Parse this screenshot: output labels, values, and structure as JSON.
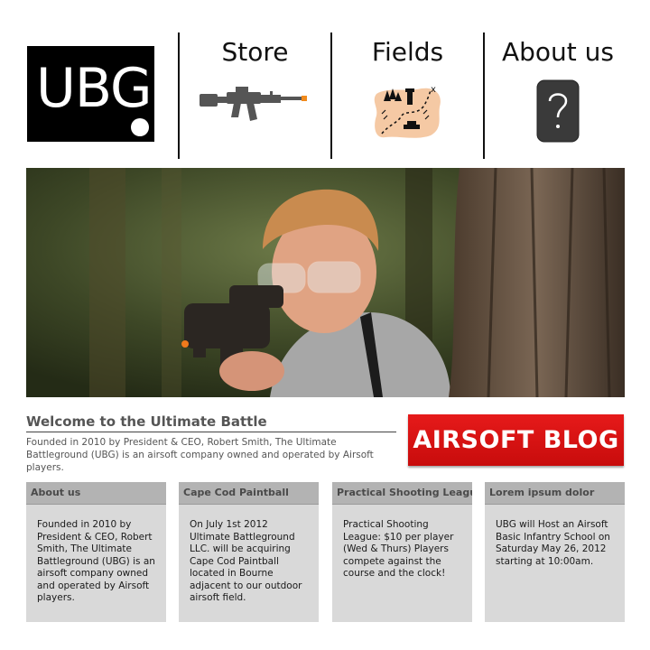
{
  "logo": {
    "text": "UBG"
  },
  "nav": [
    {
      "label": "Store",
      "icon": "rifle-icon"
    },
    {
      "label": "Fields",
      "icon": "treasure-map-icon"
    },
    {
      "label": "About us",
      "icon": "question-mark-icon"
    }
  ],
  "welcome": {
    "title": "Welcome to the Ultimate Battle",
    "text": "Founded in 2010 by President & CEO, Robert Smith, The Ultimate Battleground (UBG) is an airsoft company owned and operated by Airsoft players."
  },
  "blog_button": {
    "label": "AIRSOFT BLOG"
  },
  "columns": [
    {
      "title": "About us",
      "text": "Founded in 2010 by President & CEO, Robert Smith, The Ultimate Battleground (UBG) is an airsoft company owned and operated by Airsoft players."
    },
    {
      "title": "Cape Cod Paintball",
      "text": "On July 1st 2012 Ultimate Battleground LLC. will be acquiring Cape Cod Paintball located in Bourne adjacent to our outdoor airsoft field."
    },
    {
      "title": "Practical Shooting League:",
      "text": "Practical Shooting League: $10 per player (Wed & Thurs) Players compete against the course and the clock!"
    },
    {
      "title": "Lorem ipsum dolor",
      "text": "UBG will Host an Airsoft Basic Infantry School on Saturday May 26, 2012 starting at 10:00am."
    }
  ],
  "colors": {
    "accent": "#d81414",
    "header_bg": "#000000",
    "column_bg": "#d9d9d9",
    "column_head_bg": "#b3b3b3"
  }
}
